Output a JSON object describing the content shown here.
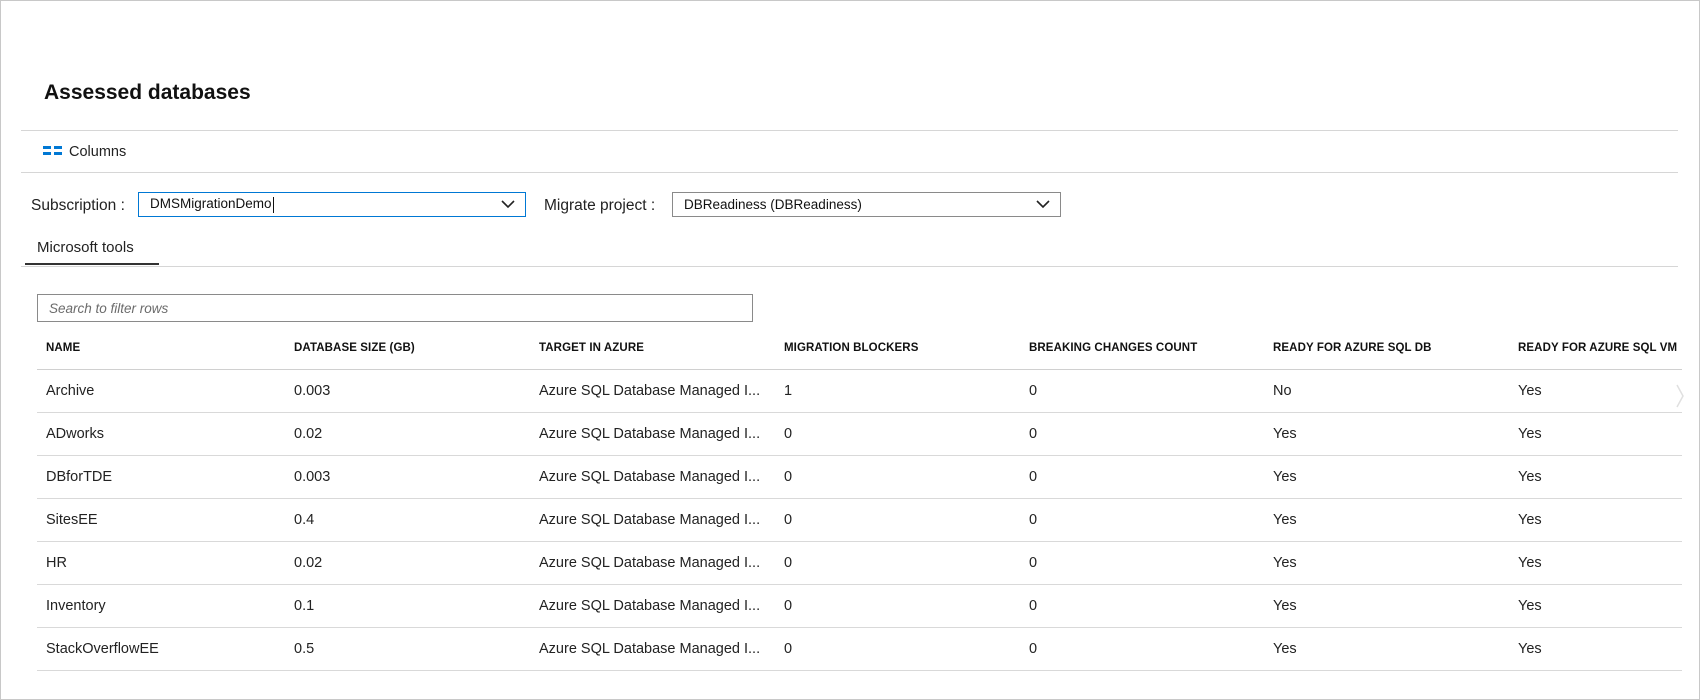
{
  "page": {
    "title": "Assessed databases"
  },
  "toolbar": {
    "columns_label": "Columns"
  },
  "filters": {
    "subscription_label": "Subscription :",
    "subscription_value": "DMSMigrationDemo",
    "project_label": "Migrate project :",
    "project_value": "DBReadiness (DBReadiness)"
  },
  "tabs": [
    {
      "label": "Microsoft tools"
    }
  ],
  "search": {
    "placeholder": "Search to filter rows"
  },
  "table": {
    "headers": [
      "NAME",
      "DATABASE SIZE (GB)",
      "TARGET IN AZURE",
      "MIGRATION BLOCKERS",
      "BREAKING CHANGES COUNT",
      "READY FOR AZURE SQL DB",
      "READY FOR AZURE SQL VM"
    ],
    "rows": [
      [
        "Archive",
        "0.003",
        "Azure SQL Database Managed I...",
        "1",
        "0",
        "No",
        "Yes"
      ],
      [
        "ADworks",
        "0.02",
        "Azure SQL Database Managed I...",
        "0",
        "0",
        "Yes",
        "Yes"
      ],
      [
        "DBforTDE",
        "0.003",
        "Azure SQL Database Managed I...",
        "0",
        "0",
        "Yes",
        "Yes"
      ],
      [
        "SitesEE",
        "0.4",
        "Azure SQL Database Managed I...",
        "0",
        "0",
        "Yes",
        "Yes"
      ],
      [
        "HR",
        "0.02",
        "Azure SQL Database Managed I...",
        "0",
        "0",
        "Yes",
        "Yes"
      ],
      [
        "Inventory",
        "0.1",
        "Azure SQL Database Managed I...",
        "0",
        "0",
        "Yes",
        "Yes"
      ],
      [
        "StackOverflowEE",
        "0.5",
        "Azure SQL Database Managed I...",
        "0",
        "0",
        "Yes",
        "Yes"
      ]
    ]
  },
  "icons": {
    "columns": "columns-icon",
    "dropdown": "chevron-down-icon",
    "scroll": "chevron-right-icon"
  },
  "colors": {
    "accent": "#0078d4",
    "border": "#8a8a8a",
    "divider": "#d6d6d6"
  }
}
